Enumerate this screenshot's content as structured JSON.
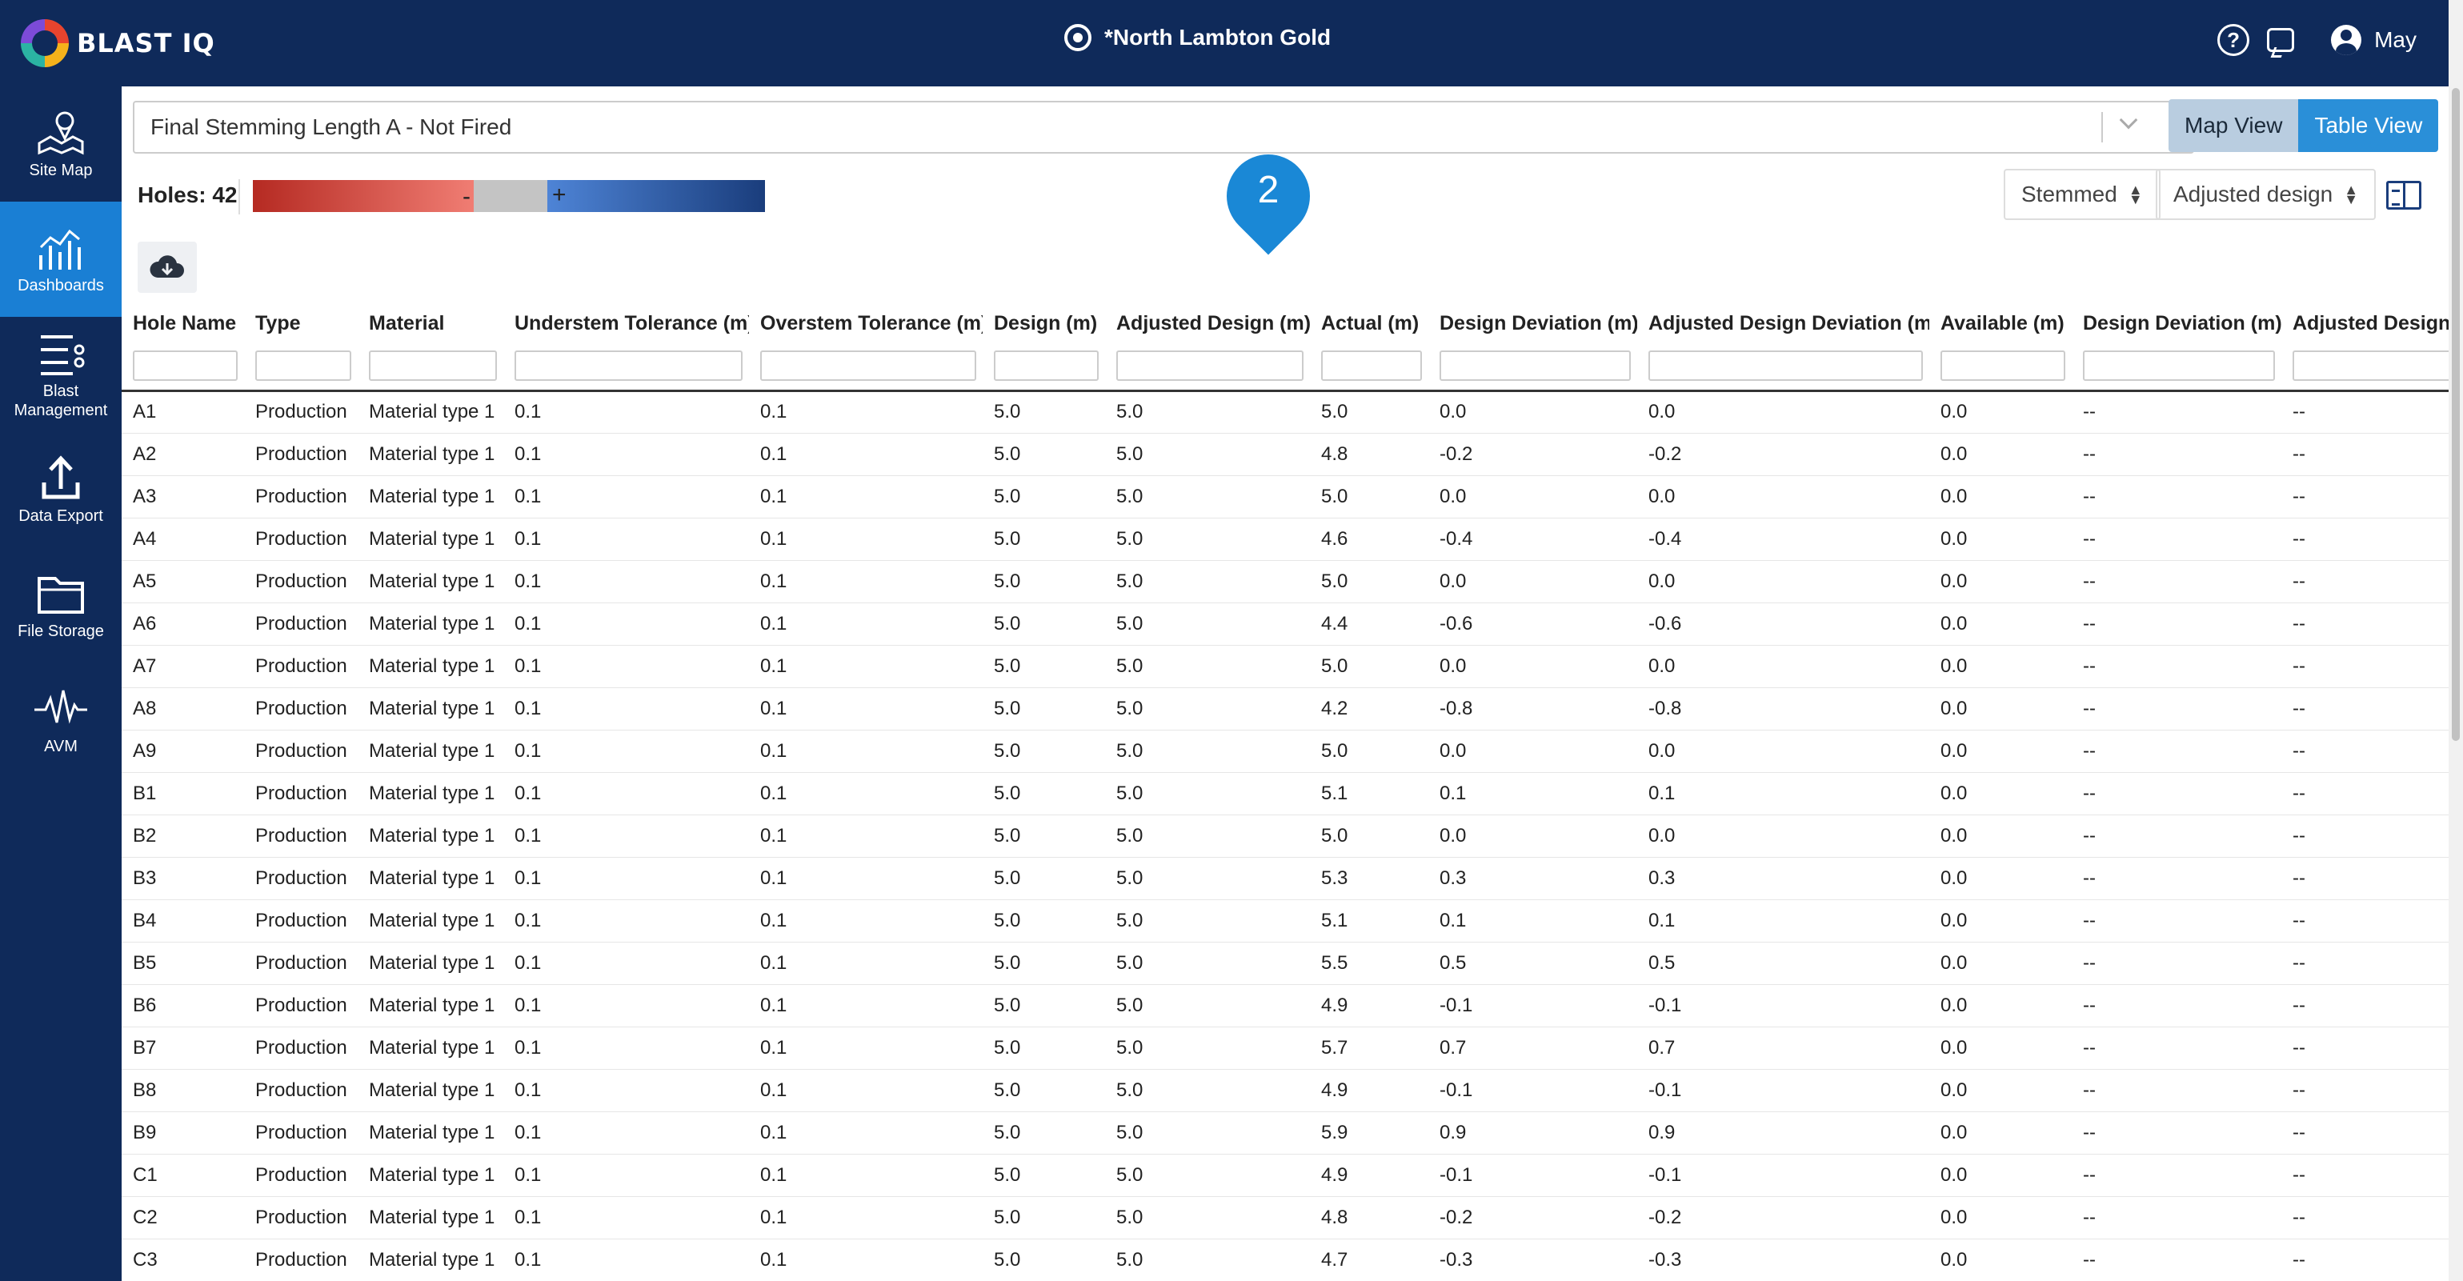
{
  "app": {
    "logo_text": "BLAST IQ",
    "site_name": "*North Lambton Gold",
    "user_name": "May"
  },
  "sidebar": {
    "items": [
      {
        "label": "Site Map",
        "icon": "map-icon"
      },
      {
        "label": "Dashboards",
        "icon": "dashboard-icon"
      },
      {
        "label": "Blast Management",
        "icon": "list-icon"
      },
      {
        "label": "Data Export",
        "icon": "upload-icon"
      },
      {
        "label": "File Storage",
        "icon": "folder-icon"
      },
      {
        "label": "AVM",
        "icon": "waveform-icon"
      }
    ],
    "active": "Dashboards"
  },
  "dashboard_select": {
    "value": "Final Stemming Length A - Not Fired"
  },
  "views": {
    "map_label": "Map View",
    "table_label": "Table View",
    "active": "Table View"
  },
  "summary": {
    "holes_label": "Holes: 42",
    "minus": "-",
    "plus": "+"
  },
  "pin": {
    "number": "2"
  },
  "controls": {
    "stemmed": "Stemmed",
    "adjusted_design": "Adjusted design"
  },
  "colors": {
    "brand": "#0f2a5a",
    "accent": "#1a88d6",
    "negative": "#b52a22",
    "positive": "#1a3d7c"
  },
  "table": {
    "columns": [
      "Hole Name",
      "Type",
      "Material",
      "Understem Tolerance (m)",
      "Overstem Tolerance (m)",
      "Design (m)",
      "Adjusted Design (m)",
      "Actual (m)",
      "Design Deviation (m)",
      "Adjusted Design Deviation (m)",
      "Available (m)",
      "Design Deviation (m)",
      "Adjusted Design Deviation (m)"
    ],
    "rows": [
      [
        "A1",
        "Production",
        "Material type 1",
        "0.1",
        "0.1",
        "5.0",
        "5.0",
        "5.0",
        "0.0",
        "0.0",
        "0.0",
        "--",
        "--"
      ],
      [
        "A2",
        "Production",
        "Material type 1",
        "0.1",
        "0.1",
        "5.0",
        "5.0",
        "4.8",
        "-0.2",
        "-0.2",
        "0.0",
        "--",
        "--"
      ],
      [
        "A3",
        "Production",
        "Material type 1",
        "0.1",
        "0.1",
        "5.0",
        "5.0",
        "5.0",
        "0.0",
        "0.0",
        "0.0",
        "--",
        "--"
      ],
      [
        "A4",
        "Production",
        "Material type 1",
        "0.1",
        "0.1",
        "5.0",
        "5.0",
        "4.6",
        "-0.4",
        "-0.4",
        "0.0",
        "--",
        "--"
      ],
      [
        "A5",
        "Production",
        "Material type 1",
        "0.1",
        "0.1",
        "5.0",
        "5.0",
        "5.0",
        "0.0",
        "0.0",
        "0.0",
        "--",
        "--"
      ],
      [
        "A6",
        "Production",
        "Material type 1",
        "0.1",
        "0.1",
        "5.0",
        "5.0",
        "4.4",
        "-0.6",
        "-0.6",
        "0.0",
        "--",
        "--"
      ],
      [
        "A7",
        "Production",
        "Material type 1",
        "0.1",
        "0.1",
        "5.0",
        "5.0",
        "5.0",
        "0.0",
        "0.0",
        "0.0",
        "--",
        "--"
      ],
      [
        "A8",
        "Production",
        "Material type 1",
        "0.1",
        "0.1",
        "5.0",
        "5.0",
        "4.2",
        "-0.8",
        "-0.8",
        "0.0",
        "--",
        "--"
      ],
      [
        "A9",
        "Production",
        "Material type 1",
        "0.1",
        "0.1",
        "5.0",
        "5.0",
        "5.0",
        "0.0",
        "0.0",
        "0.0",
        "--",
        "--"
      ],
      [
        "B1",
        "Production",
        "Material type 1",
        "0.1",
        "0.1",
        "5.0",
        "5.0",
        "5.1",
        "0.1",
        "0.1",
        "0.0",
        "--",
        "--"
      ],
      [
        "B2",
        "Production",
        "Material type 1",
        "0.1",
        "0.1",
        "5.0",
        "5.0",
        "5.0",
        "0.0",
        "0.0",
        "0.0",
        "--",
        "--"
      ],
      [
        "B3",
        "Production",
        "Material type 1",
        "0.1",
        "0.1",
        "5.0",
        "5.0",
        "5.3",
        "0.3",
        "0.3",
        "0.0",
        "--",
        "--"
      ],
      [
        "B4",
        "Production",
        "Material type 1",
        "0.1",
        "0.1",
        "5.0",
        "5.0",
        "5.1",
        "0.1",
        "0.1",
        "0.0",
        "--",
        "--"
      ],
      [
        "B5",
        "Production",
        "Material type 1",
        "0.1",
        "0.1",
        "5.0",
        "5.0",
        "5.5",
        "0.5",
        "0.5",
        "0.0",
        "--",
        "--"
      ],
      [
        "B6",
        "Production",
        "Material type 1",
        "0.1",
        "0.1",
        "5.0",
        "5.0",
        "4.9",
        "-0.1",
        "-0.1",
        "0.0",
        "--",
        "--"
      ],
      [
        "B7",
        "Production",
        "Material type 1",
        "0.1",
        "0.1",
        "5.0",
        "5.0",
        "5.7",
        "0.7",
        "0.7",
        "0.0",
        "--",
        "--"
      ],
      [
        "B8",
        "Production",
        "Material type 1",
        "0.1",
        "0.1",
        "5.0",
        "5.0",
        "4.9",
        "-0.1",
        "-0.1",
        "0.0",
        "--",
        "--"
      ],
      [
        "B9",
        "Production",
        "Material type 1",
        "0.1",
        "0.1",
        "5.0",
        "5.0",
        "5.9",
        "0.9",
        "0.9",
        "0.0",
        "--",
        "--"
      ],
      [
        "C1",
        "Production",
        "Material type 1",
        "0.1",
        "0.1",
        "5.0",
        "5.0",
        "4.9",
        "-0.1",
        "-0.1",
        "0.0",
        "--",
        "--"
      ],
      [
        "C2",
        "Production",
        "Material type 1",
        "0.1",
        "0.1",
        "5.0",
        "5.0",
        "4.8",
        "-0.2",
        "-0.2",
        "0.0",
        "--",
        "--"
      ],
      [
        "C3",
        "Production",
        "Material type 1",
        "0.1",
        "0.1",
        "5.0",
        "5.0",
        "4.7",
        "-0.3",
        "-0.3",
        "0.0",
        "--",
        "--"
      ]
    ]
  }
}
